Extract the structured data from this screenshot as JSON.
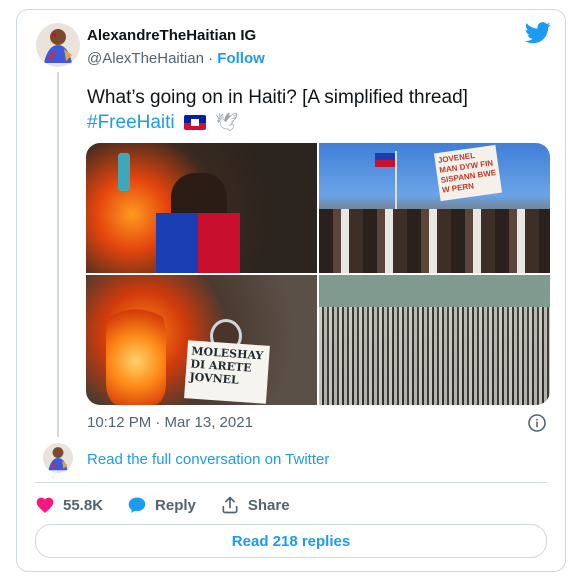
{
  "tweet": {
    "author": {
      "name": "AlexandreTheHaitian IG",
      "handle": "@AlexTheHaitian",
      "separator": "·",
      "follow_label": "Follow"
    },
    "text": "What’s going on in Haiti? [A simplified thread]",
    "hashtag": "#FreeHaiti",
    "emojis": [
      "haiti-flag",
      "dove"
    ],
    "timestamp": "10:12 PM · Mar 13, 2021",
    "read_conversation_label": "Read the full conversation on Twitter",
    "likes": "55.8K",
    "reply_label": "Reply",
    "share_label": "Share",
    "read_replies_label": "Read 218 replies",
    "photo_text": {
      "p2_sign": "JOVENEL MAN DYW FIN SISPANN BWE W PERN",
      "p3_sign": "MOLESHAY DI ARETE JOVNEL"
    }
  },
  "colors": {
    "accent": "#1d9bf0",
    "like": "#f91880",
    "text": "#0f1419",
    "muted": "#536471",
    "border": "#cfd9de"
  },
  "icons": [
    "twitter-logo-icon",
    "info-icon",
    "heart-icon",
    "reply-bubble-icon",
    "share-icon"
  ]
}
